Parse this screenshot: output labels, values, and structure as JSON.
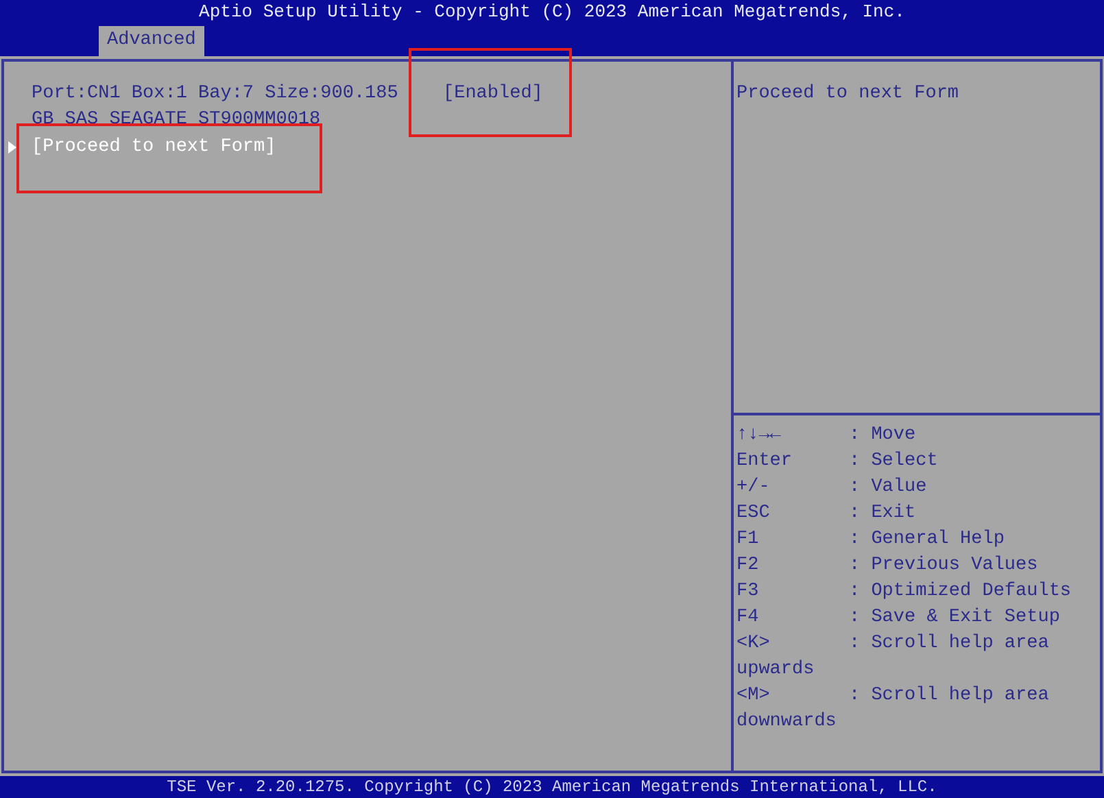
{
  "title": "Aptio Setup Utility - Copyright (C) 2023 American Megatrends, Inc.",
  "tabs": [
    {
      "label": "Advanced",
      "selected": true
    }
  ],
  "items": [
    {
      "label": "Port:CN1 Box:1 Bay:7 Size:900.185 GB SAS SEAGATE ST900MM0018",
      "value": "[Enabled]",
      "selected": false
    },
    {
      "label": "[Proceed to next Form]",
      "selected": true
    }
  ],
  "help_text": "Proceed to next Form",
  "keys": [
    {
      "key": "↑↓→←",
      "action": ": Move"
    },
    {
      "key": "Enter",
      "action": ": Select"
    },
    {
      "key": "+/-",
      "action": ": Value"
    },
    {
      "key": "ESC",
      "action": ": Exit"
    },
    {
      "key": "F1",
      "action": ": General Help"
    },
    {
      "key": "F2",
      "action": ": Previous Values"
    },
    {
      "key": "F3",
      "action": ": Optimized Defaults"
    },
    {
      "key": "F4",
      "action": ": Save & Exit Setup"
    },
    {
      "key": "<K>",
      "action": ": Scroll help area upwards"
    },
    {
      "key": "<M>",
      "action": ": Scroll help area downwards"
    }
  ],
  "footer": "TSE Ver. 2.20.1275. Copyright (C) 2023 American Megatrends International, LLC."
}
